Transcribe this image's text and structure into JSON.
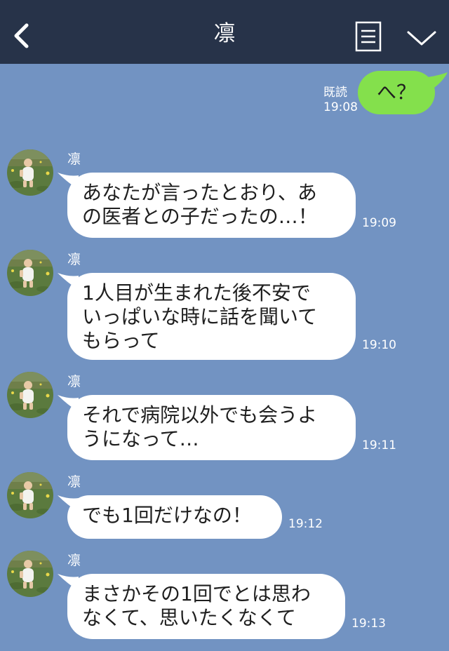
{
  "header": {
    "title": "凛",
    "back_icon": "chevron-left-icon",
    "menu_icon": "list-icon",
    "expand_icon": "chevron-down-icon"
  },
  "colors": {
    "header_bg": "#273349",
    "chat_bg": "#7293c2",
    "sent_bubble": "#84e04c",
    "received_bubble": "#ffffff"
  },
  "sent": {
    "text": "へ？",
    "read_label": "既読",
    "time": "19:08"
  },
  "messages": [
    {
      "sender": "凛",
      "text": "あなたが言ったとおり、あ\nの医者との子だったの…！",
      "time": "19:09"
    },
    {
      "sender": "凛",
      "text": "1人目が生まれた後不安で\nいっぱいな時に話を聞いて\nもらって",
      "time": "19:10"
    },
    {
      "sender": "凛",
      "text": "それで病院以外でも会うよ\nうになって…",
      "time": "19:11"
    },
    {
      "sender": "凛",
      "text": "でも1回だけなの！",
      "time": "19:12"
    },
    {
      "sender": "凛",
      "text": "まさかその1回でとは思わ\nなくて、思いたくなくて",
      "time": "19:13"
    }
  ]
}
